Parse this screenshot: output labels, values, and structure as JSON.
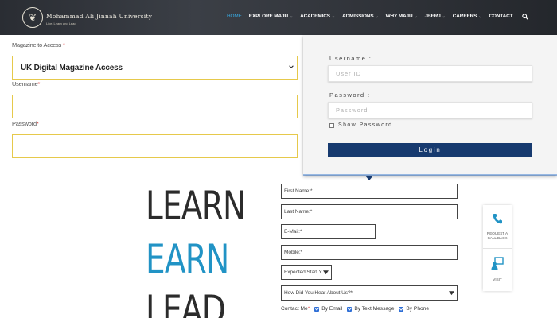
{
  "header": {
    "logo_icon": "university-crest-icon",
    "university_name": "Mohammad Ali Jinnah University",
    "university_tagline": "Live, Learn and Lead",
    "nav": [
      {
        "label": "HOME",
        "active": true,
        "dropdown": false
      },
      {
        "label": "EXPLORE MAJU",
        "active": false,
        "dropdown": true
      },
      {
        "label": "ACADEMICS",
        "active": false,
        "dropdown": true
      },
      {
        "label": "ADMISSIONS",
        "active": false,
        "dropdown": true
      },
      {
        "label": "WHY MAJU",
        "active": false,
        "dropdown": true
      },
      {
        "label": "JBERJ",
        "active": false,
        "dropdown": true
      },
      {
        "label": "CAREERS",
        "active": false,
        "dropdown": true
      },
      {
        "label": "CONTACT",
        "active": false,
        "dropdown": false
      }
    ],
    "search_icon": "search-icon",
    "active_color": "#38a8e0"
  },
  "magazine_form": {
    "access_label": "Magazine to Access",
    "access_required": "*",
    "access_value": "UK Digital Magazine Access",
    "username_label": "Username",
    "username_required": "*",
    "username_value": "",
    "password_label": "Password",
    "password_required": "*",
    "password_value": "",
    "field_border_color": "#e6c94b"
  },
  "portal_login": {
    "username_label": "Username :",
    "username_placeholder": "User ID",
    "password_label": "Password :",
    "password_placeholder": "Password",
    "show_password_label": "Show Password",
    "show_password_checked": false,
    "login_label": "Login",
    "button_color": "#173a6f"
  },
  "slogan": {
    "word1": "LEARN",
    "word2": "EARN",
    "word3": "LEAD",
    "accent_color": "#2193c5"
  },
  "inquiry_form": {
    "first_name": "First Name:*",
    "last_name": "Last Name:*",
    "email": "E-Mail:*",
    "mobile": "Mobile:*",
    "expected_start": "Expected Start Y",
    "heard_about": "How Did You Hear About Us?*",
    "contact_label": "Contact Me",
    "contact_required": "*",
    "contact_options": [
      {
        "label": "By Email",
        "checked": true
      },
      {
        "label": "By Text Message",
        "checked": true
      },
      {
        "label": "By Phone",
        "checked": true
      }
    ]
  },
  "side_widgets": {
    "callback_icon": "phone-icon",
    "callback_line1": "REQUEST A",
    "callback_line2": "CALL BACK",
    "visit_icon": "visit-icon",
    "visit_label": "VISIT",
    "icon_color": "#2193c5"
  }
}
